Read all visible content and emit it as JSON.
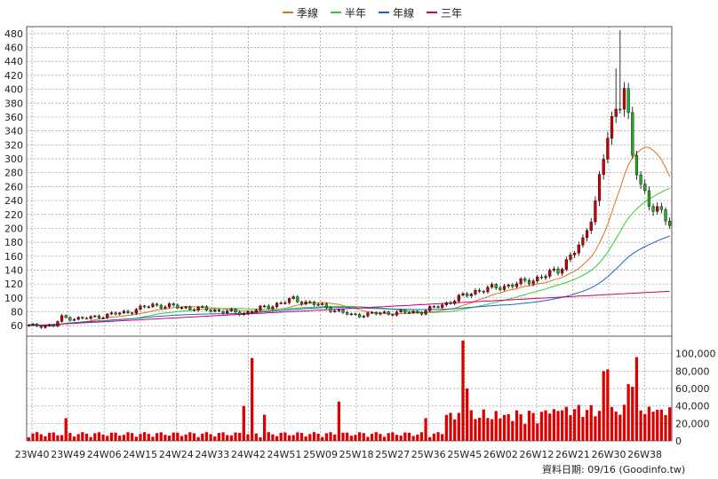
{
  "chart_data": {
    "type": "candlestick",
    "legend": [
      {
        "name": "季線",
        "color": "#e07020"
      },
      {
        "name": "半年",
        "color": "#33cc33"
      },
      {
        "name": "年線",
        "color": "#2060d0"
      },
      {
        "name": "三年",
        "color": "#cc0066"
      }
    ],
    "x_tick_labels": [
      "23W40",
      "23W49",
      "24W06",
      "24W15",
      "24W24",
      "24W33",
      "24W42",
      "24W51",
      "25W09",
      "25W18",
      "25W27",
      "25W36",
      "25W45",
      "26W02",
      "26W12",
      "26W21",
      "26W30",
      "26W38"
    ],
    "price_axis": {
      "ticks": [
        60,
        80,
        100,
        120,
        140,
        160,
        180,
        200,
        220,
        240,
        260,
        280,
        300,
        320,
        340,
        360,
        380,
        400,
        420,
        440,
        460,
        480
      ],
      "range": [
        45,
        490
      ]
    },
    "volume_axis": {
      "ticks": [
        "0",
        "20,000",
        "40,000",
        "60,000",
        "80,000",
        "100,000"
      ],
      "range": [
        0,
        120000
      ]
    },
    "colors": {
      "up": "#cc0000",
      "down": "#22aa22",
      "volume": "#dd0000",
      "grid": "#999999"
    },
    "source_text": "資料日期: 09/16  (Goodinfo.tw)",
    "ohlc": [],
    "volume": [],
    "ma": {
      "季線": [],
      "半年": [],
      "年線": [],
      "三年": []
    }
  }
}
